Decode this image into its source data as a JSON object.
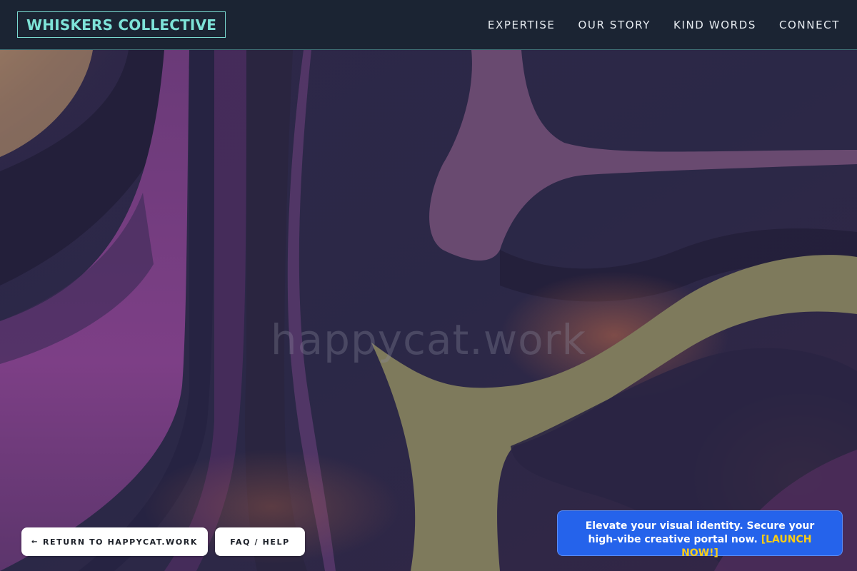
{
  "header": {
    "brand": "WHISKERS COLLECTIVE",
    "nav": [
      {
        "label": "EXPERTISE"
      },
      {
        "label": "OUR STORY"
      },
      {
        "label": "KIND WORDS"
      },
      {
        "label": "CONNECT"
      }
    ]
  },
  "hero": {
    "domain_text": "happycat.work"
  },
  "footer": {
    "return_arrow": "←",
    "return_label": "RETURN TO HAPPYCAT.WORK",
    "faq_label": "FAQ / HELP"
  },
  "promo": {
    "text": "Elevate your visual identity. Secure your high-vibe creative portal now.",
    "cta": "[LAUNCH NOW!]"
  },
  "colors": {
    "header_bg": "#1b2433",
    "brand_accent": "#7ee3d8",
    "promo_bg": "#2563eb",
    "cta_yellow": "#facc15"
  }
}
